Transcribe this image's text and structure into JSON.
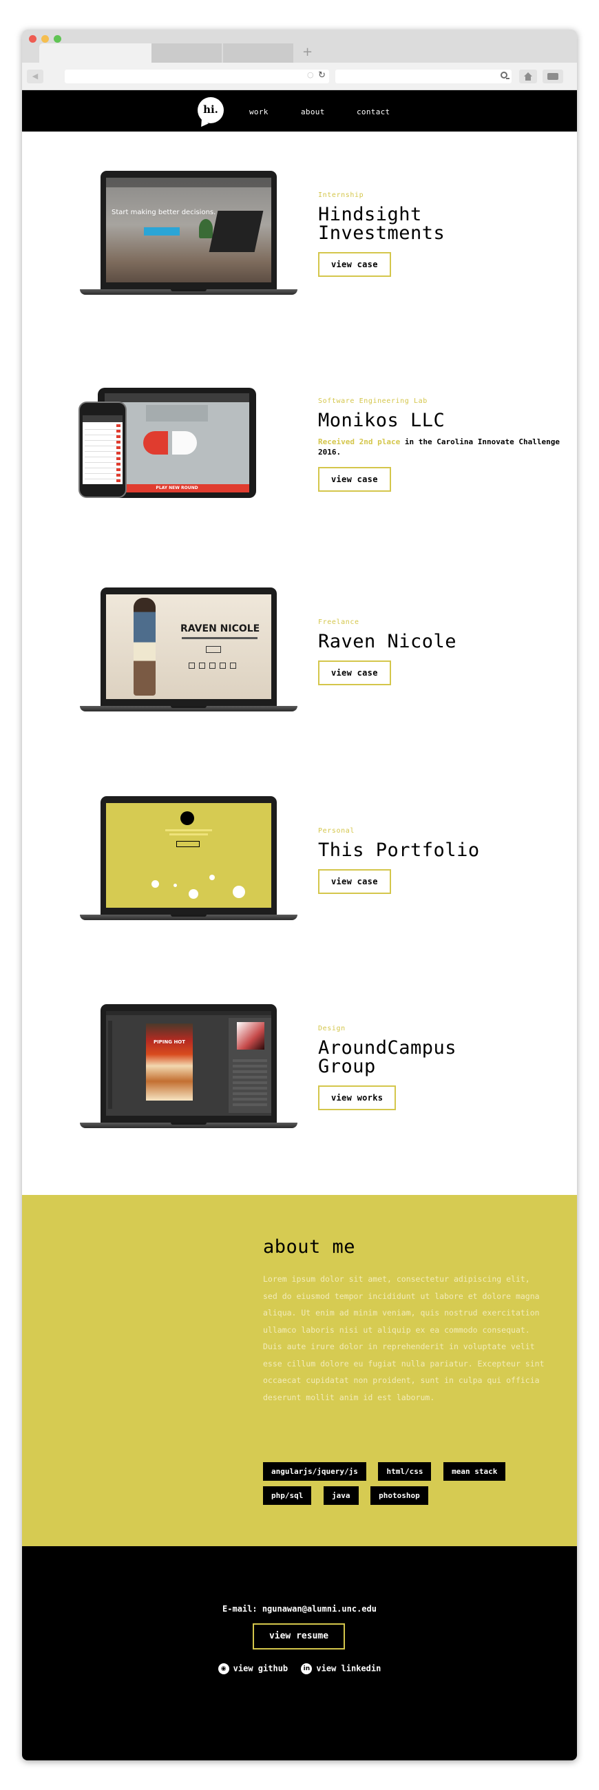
{
  "browser": {
    "tab_plus": "+"
  },
  "nav": {
    "logo": "hi.",
    "links": [
      "work",
      "about",
      "contact"
    ]
  },
  "projects": [
    {
      "category": "Internship",
      "title_line1": "Hindsight",
      "title_line2": "Investments",
      "button": "view case",
      "screen": {
        "headline": "Start making better decisions."
      }
    },
    {
      "category": "Software Engineering Lab",
      "title_line1": "Monikos LLC",
      "desc_highlight": "Received 2nd place",
      "desc_rest": " in the Carolina Innovate Challenge 2016.",
      "button": "view case",
      "screen": {
        "play": "PLAY NEW ROUND"
      }
    },
    {
      "category": "Freelance",
      "title_line1": "Raven Nicole",
      "button": "view case",
      "screen": {
        "name": "RAVEN NICOLE"
      }
    },
    {
      "category": "Personal",
      "title_line1": "This Portfolio",
      "button": "view case"
    },
    {
      "category": "Design",
      "title_line1": "AroundCampus",
      "title_line2": "Group",
      "button": "view works",
      "screen": {
        "poster": "PIPING HOT"
      }
    }
  ],
  "about": {
    "title": "about me",
    "body": "Lorem ipsum dolor sit amet, consectetur adipiscing elit, sed do eiusmod tempor incididunt ut labore et dolore magna aliqua. Ut enim ad minim veniam, quis nostrud exercitation ullamco laboris nisi ut aliquip ex ea commodo consequat. Duis aute irure dolor in reprehenderit in voluptate velit esse cillum dolore eu fugiat nulla pariatur. Excepteur sint occaecat cupidatat non proident, sunt in culpa qui officia deserunt mollit anim id est laborum.",
    "tags": [
      "angularjs/jquery/js",
      "html/css",
      "mean stack",
      "php/sql",
      "java",
      "photoshop"
    ]
  },
  "footer": {
    "email": "E-mail: ngunawan@alumni.unc.edu",
    "resume": "view resume",
    "github": "view github",
    "linkedin": "view linkedin"
  },
  "colors": {
    "accent": "#d4c64b",
    "about_bg": "#d6cb52",
    "nav_bg": "#000000"
  }
}
